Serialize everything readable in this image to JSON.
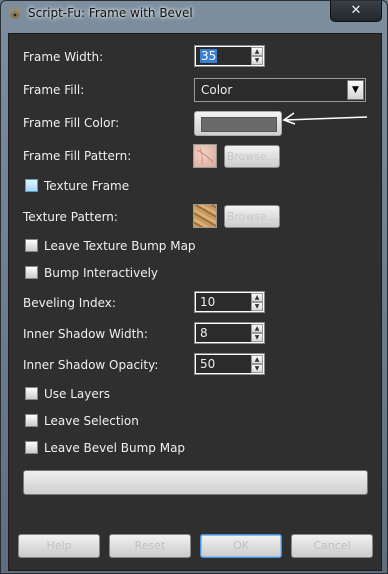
{
  "window": {
    "title": "Script-Fu: Frame with Bevel",
    "close_label": "✕"
  },
  "form": {
    "frame_width": {
      "label": "Frame Width:",
      "value": "35"
    },
    "frame_fill": {
      "label": "Frame Fill:",
      "value": "Color"
    },
    "frame_fill_color": {
      "label": "Frame Fill Color:",
      "color": "#6a6a6a"
    },
    "frame_fill_pattern": {
      "label": "Frame Fill Pattern:",
      "browse_label": "Browse..."
    },
    "texture_frame": {
      "label": "Texture Frame",
      "checked": true
    },
    "texture_pattern": {
      "label": "Texture Pattern:",
      "browse_label": "Browse..."
    },
    "leave_texture_bump_map": {
      "label": "Leave Texture Bump Map",
      "checked": false
    },
    "bump_interactively": {
      "label": "Bump Interactively",
      "checked": false
    },
    "beveling_index": {
      "label": "Beveling Index:",
      "value": "10"
    },
    "inner_shadow_width": {
      "label": "Inner Shadow Width:",
      "value": "8"
    },
    "inner_shadow_opacity": {
      "label": "Inner Shadow Opacity:",
      "value": "50"
    },
    "use_layers": {
      "label": "Use Layers",
      "checked": false
    },
    "leave_selection": {
      "label": "Leave Selection",
      "checked": false
    },
    "leave_bevel_bump_map": {
      "label": "Leave Bevel Bump Map",
      "checked": false
    }
  },
  "progress": {
    "value": 0
  },
  "buttons": {
    "help": "Help",
    "reset": "Reset",
    "ok": "OK",
    "cancel": "Cancel"
  },
  "colors": {
    "dialog_bg": "#2f2f2f",
    "label_text": "#f0f0f0",
    "selection": "#3b7ed6"
  }
}
